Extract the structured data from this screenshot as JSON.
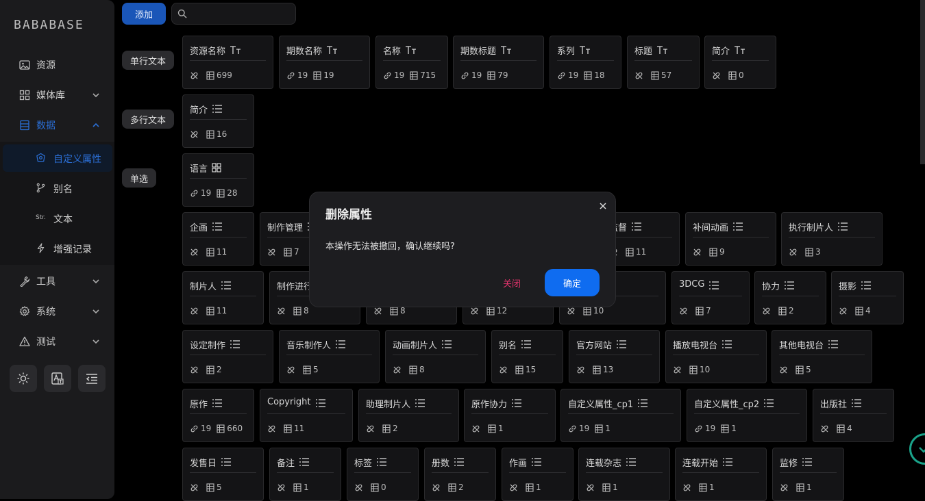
{
  "app": {
    "logo": "BABABASE"
  },
  "sidebar": {
    "items": [
      {
        "label": "资源",
        "icon": "image-icon"
      },
      {
        "label": "媒体库",
        "icon": "grid-icon"
      },
      {
        "label": "数据",
        "icon": "database-icon"
      },
      {
        "label": "工具",
        "icon": "wrench-icon"
      },
      {
        "label": "系统",
        "icon": "gear-icon"
      },
      {
        "label": "测试",
        "icon": "warning-icon"
      }
    ],
    "sub_items": [
      {
        "label": "自定义属性",
        "icon": "custom-property-icon"
      },
      {
        "label": "别名",
        "icon": "branch-icon"
      },
      {
        "label": "文本",
        "icon": "str-icon",
        "icon_text": "Str."
      },
      {
        "label": "增强记录",
        "icon": "bolt-icon"
      }
    ],
    "bottom_buttons": [
      "theme-toggle-icon",
      "language-icon",
      "collapse-menu-icon"
    ]
  },
  "toolbar": {
    "add_label": "添加",
    "search_placeholder": ""
  },
  "categories": [
    "单行文本",
    "多行文本",
    "单选"
  ],
  "cards": [
    {
      "name": "资源名称",
      "type": "text",
      "links": null,
      "count": "699"
    },
    {
      "name": "期数名称",
      "type": "text",
      "links": "19",
      "count": "19"
    },
    {
      "name": "名称",
      "type": "text",
      "links": "19",
      "count": "715"
    },
    {
      "name": "期数标题",
      "type": "text",
      "links": "19",
      "count": "79"
    },
    {
      "name": "系列",
      "type": "text",
      "links": "19",
      "count": "18"
    },
    {
      "name": "标题",
      "type": "text",
      "links": null,
      "count": "57"
    },
    {
      "name": "简介",
      "type": "text",
      "links": null,
      "count": "0"
    },
    {
      "name": "简介",
      "type": "list",
      "links": null,
      "count": "16"
    },
    {
      "name": "语言",
      "type": "grid",
      "links": "19",
      "count": "28"
    },
    {
      "name": "企画",
      "type": "list",
      "links": null,
      "count": "11"
    },
    {
      "name": "制作管理",
      "type": "list",
      "links": null,
      "count": "7"
    },
    {
      "name": "监督",
      "type": "list",
      "links": null,
      "count": "11"
    },
    {
      "name": "补间动画",
      "type": "list",
      "links": null,
      "count": "9"
    },
    {
      "name": "执行制片人",
      "type": "list",
      "links": null,
      "count": "3"
    },
    {
      "name": "制片人",
      "type": "list",
      "links": null,
      "count": "11"
    },
    {
      "name": "制作进行",
      "type": "list",
      "links": null,
      "count": "8"
    },
    {
      "name": "",
      "type": "none",
      "links": null,
      "count": "8"
    },
    {
      "name": "",
      "type": "none",
      "links": null,
      "count": "12"
    },
    {
      "name": "镜",
      "type": "list",
      "links": null,
      "count": "10"
    },
    {
      "name": "3DCG",
      "type": "list",
      "links": null,
      "count": "7"
    },
    {
      "name": "协力",
      "type": "list",
      "links": null,
      "count": "2"
    },
    {
      "name": "摄影",
      "type": "list",
      "links": null,
      "count": "4"
    },
    {
      "name": "设定制作",
      "type": "list",
      "links": null,
      "count": "2"
    },
    {
      "name": "音乐制作人",
      "type": "list",
      "links": null,
      "count": "5"
    },
    {
      "name": "动画制片人",
      "type": "list",
      "links": null,
      "count": "8"
    },
    {
      "name": "别名",
      "type": "list",
      "links": null,
      "count": "15"
    },
    {
      "name": "官方网站",
      "type": "list",
      "links": null,
      "count": "13"
    },
    {
      "name": "播放电视台",
      "type": "list",
      "links": null,
      "count": "10"
    },
    {
      "name": "其他电视台",
      "type": "list",
      "links": null,
      "count": "5"
    },
    {
      "name": "原作",
      "type": "list",
      "links": "19",
      "count": "660"
    },
    {
      "name": "Copyright",
      "type": "list",
      "links": null,
      "count": "11"
    },
    {
      "name": "助理制片人",
      "type": "list",
      "links": null,
      "count": "2"
    },
    {
      "name": "原作协力",
      "type": "list",
      "links": null,
      "count": "1"
    },
    {
      "name": "自定义属性_cp1",
      "type": "list",
      "links": "19",
      "count": "1"
    },
    {
      "name": "自定义属性_cp2",
      "type": "list",
      "links": "19",
      "count": "1"
    },
    {
      "name": "出版社",
      "type": "list",
      "links": null,
      "count": "4"
    },
    {
      "name": "发售日",
      "type": "list",
      "links": null,
      "count": "5"
    },
    {
      "name": "备注",
      "type": "list",
      "links": null,
      "count": "1"
    },
    {
      "name": "标签",
      "type": "list",
      "links": null,
      "count": "0"
    },
    {
      "name": "册数",
      "type": "list",
      "links": null,
      "count": "2"
    },
    {
      "name": "作画",
      "type": "list",
      "links": null,
      "count": "1"
    },
    {
      "name": "连载杂志",
      "type": "list",
      "links": null,
      "count": "1"
    },
    {
      "name": "连载开始",
      "type": "list",
      "links": null,
      "count": "1"
    },
    {
      "name": "监修",
      "type": "list",
      "links": null,
      "count": "1"
    }
  ],
  "modal": {
    "title": "删除属性",
    "message": "本操作无法被撤回，确认继续吗?",
    "close_label": "关闭",
    "confirm_label": "确定"
  },
  "colors": {
    "accent": "#0f6cf0",
    "danger": "#e0336b",
    "active_nav": "#2b6fd6",
    "float": "#1aa38a"
  }
}
